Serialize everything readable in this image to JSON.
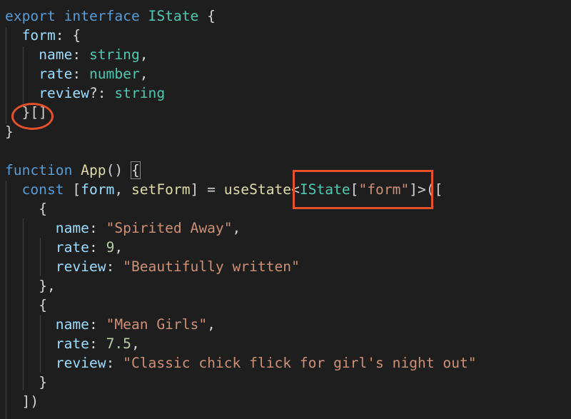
{
  "code": {
    "interface_decl": {
      "export": "export",
      "interface": "interface",
      "name": "IState",
      "open": " {"
    },
    "form_field": {
      "name": "form",
      "sep": ": {"
    },
    "name_field": {
      "name": "name",
      "sep": ": ",
      "type": "string",
      "end": ","
    },
    "rate_field": {
      "name": "rate",
      "sep": ": ",
      "type": "number",
      "end": ","
    },
    "review_field": {
      "name": "review",
      "sep": "?: ",
      "type": "string"
    },
    "array_close": "}[]",
    "interface_close": "}",
    "function_decl": {
      "keyword": "function",
      "name": "App",
      "parens": "()",
      "brace": "{"
    },
    "const_line": {
      "keyword": "const",
      "open_bracket": "[",
      "var1": "form",
      "comma": ", ",
      "var2": "setForm",
      "close_assign": "] = ",
      "hook": "useState",
      "lt": "<",
      "type": "IState",
      "idx_open": "[",
      "idx_str": "\"form\"",
      "idx_close": "]",
      "gt": ">",
      "call_open": "(["
    },
    "obj_open": "{",
    "obj_close_comma": "},",
    "obj_close": "}",
    "items": [
      {
        "name_key": "name",
        "name_val": "\"Spirited Away\"",
        "rate_key": "rate",
        "rate_val": "9",
        "review_key": "review",
        "review_val": "\"Beautifully written\""
      },
      {
        "name_key": "name",
        "name_val": "\"Mean Girls\"",
        "rate_key": "rate",
        "rate_val": "7.5",
        "review_key": "review",
        "review_val": "\"Classic chick flick for girl's night out\""
      }
    ],
    "call_close": "])"
  },
  "colors": {
    "background": "#1e1e1e",
    "keyword": "#569cd6",
    "type": "#4ec9b0",
    "function": "#dcdcaa",
    "property": "#9cdcfe",
    "string": "#ce9178",
    "number": "#b5cea8",
    "annotation": "#e4512b"
  }
}
